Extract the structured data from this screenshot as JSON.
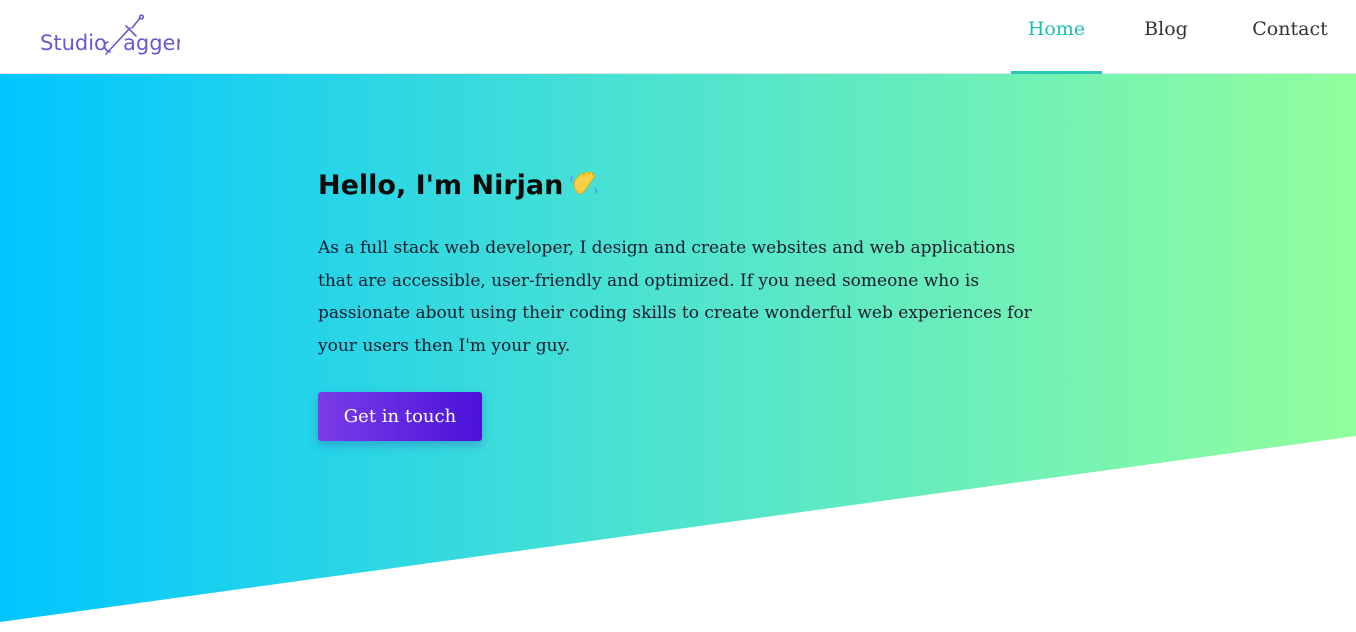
{
  "header": {
    "logo_text": "Studio Dagger",
    "nav": [
      {
        "label": "Home",
        "active": true
      },
      {
        "label": "Blog",
        "active": false
      },
      {
        "label": "Contact",
        "active": false
      }
    ]
  },
  "hero": {
    "title": "Hello, I'm Nirjan",
    "title_icon": "waving-hand-icon",
    "text": "As a full stack web developer, I design and create websites and web applications that are accessible, user-friendly and optimized. If you need someone who is passionate about using their coding skills to create wonderful web experiences for your users then I'm your guy.",
    "cta_label": "Get in touch"
  },
  "colors": {
    "accent": "#2ec4b6",
    "logo": "#6a5acd",
    "gradient_start": "#00c6ff",
    "gradient_end": "#92fe9d",
    "button_start": "#7a3de8",
    "button_end": "#4a12d8"
  }
}
